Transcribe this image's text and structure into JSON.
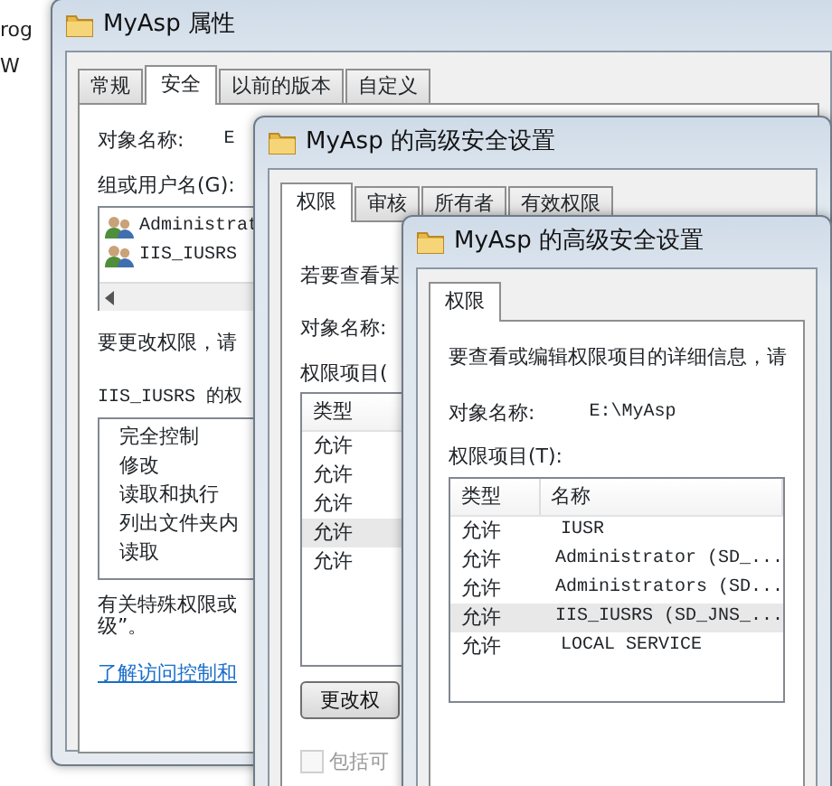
{
  "desktop_labels": [
    "rog",
    "W"
  ],
  "properties_window": {
    "title": "MyAsp 属性",
    "tabs": [
      {
        "label": "常规",
        "selected": false
      },
      {
        "label": "安全",
        "selected": true
      },
      {
        "label": "以前的版本",
        "selected": false
      },
      {
        "label": "自定义",
        "selected": false
      }
    ],
    "object_name_label": "对象名称:",
    "object_name_value": "E",
    "groups_label": "组或用户名(G):",
    "groups": [
      "Administrat",
      "IIS_IUSRS"
    ],
    "change_hint": "要更改权限，请",
    "permissions_label": "IIS_IUSRS 的权",
    "permissions": [
      "完全控制",
      "修改",
      "读取和执行",
      "列出文件夹内",
      "读取"
    ],
    "special_hint": [
      "有关特殊权限或",
      "级”。"
    ],
    "link": "了解访问控制和"
  },
  "advanced_window_back": {
    "title": "MyAsp 的高级安全设置",
    "tabs": [
      {
        "label": "权限",
        "selected": true
      },
      {
        "label": "审核",
        "selected": false
      },
      {
        "label": "所有者",
        "selected": false
      },
      {
        "label": "有效权限",
        "selected": false
      }
    ],
    "intro": "若要查看某",
    "object_name_label": "对象名称:",
    "entries_label": "权限项目(",
    "column": "类型",
    "entries": [
      {
        "type": "允许",
        "selected": false
      },
      {
        "type": "允许",
        "selected": false
      },
      {
        "type": "允许",
        "selected": false
      },
      {
        "type": "允许",
        "selected": true
      },
      {
        "type": "允许",
        "selected": false
      }
    ],
    "button": "更改权",
    "checkbox": {
      "label": "包括可",
      "checked": false,
      "disabled": true
    }
  },
  "advanced_window_front": {
    "title": "MyAsp 的高级安全设置",
    "tabs": [
      {
        "label": "权限",
        "selected": true
      }
    ],
    "intro": "要查看或编辑权限项目的详细信息，请",
    "object_name_label": "对象名称:",
    "object_name_value": "E:\\MyAsp",
    "entries_label": "权限项目(T):",
    "columns": [
      "类型",
      "名称"
    ],
    "entries": [
      {
        "type": "允许",
        "name": "IUSR",
        "selected": false
      },
      {
        "type": "允许",
        "name": "Administrator (SD_...",
        "selected": false
      },
      {
        "type": "允许",
        "name": "Administrators (SD...",
        "selected": false
      },
      {
        "type": "允许",
        "name": "IIS_IUSRS (SD_JNS_...",
        "selected": true
      },
      {
        "type": "允许",
        "name": "LOCAL SERVICE",
        "selected": false
      }
    ]
  }
}
